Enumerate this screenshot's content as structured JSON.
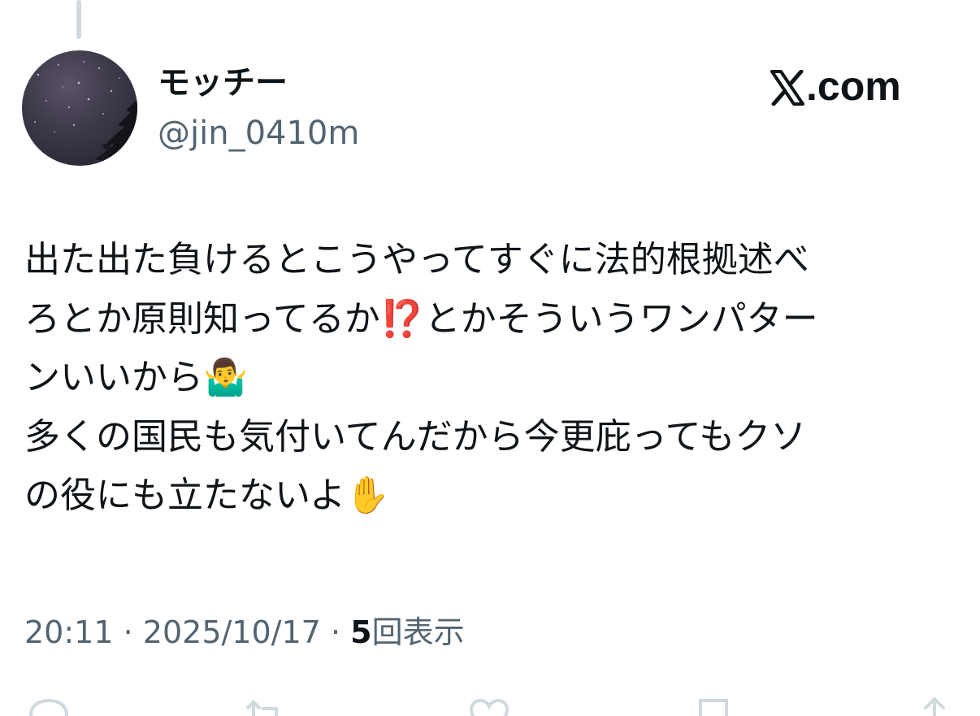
{
  "author": {
    "display_name": "モッチー",
    "handle": "@jin_0410m"
  },
  "watermark": {
    "text": ".com",
    "icon": "x-logo-icon"
  },
  "tweet": {
    "lines": [
      "出た出た負けるとこうやってすぐに法的根拠述べ",
      "ろとか原則知ってるか⁉️とかそういうワンパター",
      "ンいいから🤷‍♂️",
      "多くの国民も気付いてんだから今更庇ってもクソ",
      "の役にも立たないよ✋"
    ]
  },
  "meta": {
    "time": "20:11",
    "separator": "·",
    "date": "2025/10/17",
    "views_count": "5",
    "views_label": "回表示"
  },
  "actions": {
    "icons": [
      "reply-icon",
      "repost-icon",
      "like-icon",
      "bookmark-icon",
      "share-icon"
    ]
  },
  "colors": {
    "text_primary": "#0f1419",
    "text_secondary": "#536471",
    "thread_line": "#cfd9de",
    "background": "#ffffff"
  }
}
